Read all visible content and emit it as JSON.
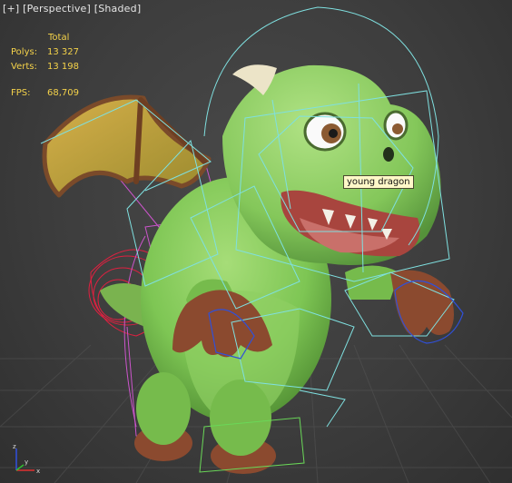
{
  "viewport": {
    "labels": [
      "[+]",
      "[Perspective]",
      "[Shaded]"
    ]
  },
  "stats": {
    "header": "Total",
    "polys_label": "Polys:",
    "polys_value": "13 327",
    "verts_label": "Verts:",
    "verts_value": "13 198",
    "fps_label": "FPS:",
    "fps_value": "68,709"
  },
  "tooltip": "young dragon",
  "axis": {
    "x": "x",
    "y": "y",
    "z": "z"
  },
  "colors": {
    "stats_text": "#f4d24a",
    "dragon_skin": "#7ec654",
    "rig_cyan": "#7fe0e0",
    "rig_magenta": "#cc55cc",
    "rig_red": "#e02040",
    "rig_blue": "#3050d8",
    "tooltip_bg": "#fff8c8"
  }
}
